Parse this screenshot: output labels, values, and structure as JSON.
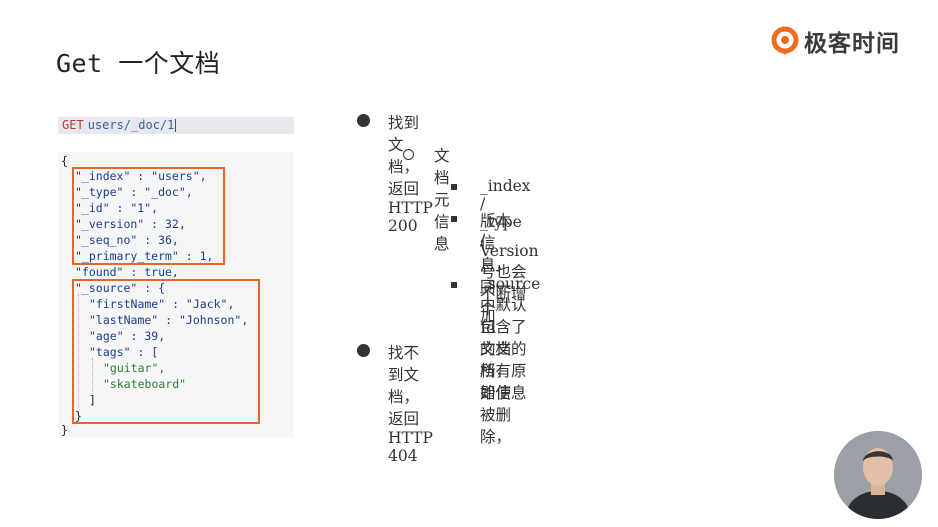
{
  "title": "Get 一个文档",
  "brand": {
    "name": "极客时间",
    "icon": "geektime-logo-icon",
    "color": "#f26b21"
  },
  "request": {
    "method": "GET",
    "path": "users/_doc/1"
  },
  "json": {
    "open": "{",
    "index_line": "\"_index\" : \"users\",",
    "type_line": "\"_type\" : \"_doc\",",
    "id_line": "\"_id\" : \"1\",",
    "version_line": "\"_version\" : 32,",
    "seq_line": "\"_seq_no\" : 36,",
    "term_line": "\"_primary_term\" : 1,",
    "found_line": "\"found\" : true,",
    "source_open": "\"_source\" : {",
    "first_line": "\"firstName\" : \"Jack\",",
    "last_line": "\"lastName\" : \"Johnson\",",
    "age_line": "\"age\" : 39,",
    "tags_line": "\"tags\" : [",
    "tag1": "\"guitar\",",
    "tag2": "\"skateboard\"",
    "tags_close": "]",
    "source_close": "}",
    "close": "}"
  },
  "bullets": {
    "found": "找到文档，返回 HTTP 200",
    "meta": "文档元信息",
    "meta_fields": "_index / _type /",
    "version_1": "版本信息，同一个 Id 的文档，即使被删除，",
    "version_2": "Version 号也会不断增加",
    "source": "_source 中默认包含了文档的所有原始信息",
    "not_found": "找不到文档，返回 HTTP 404"
  },
  "highlight_color": "#e8662a"
}
